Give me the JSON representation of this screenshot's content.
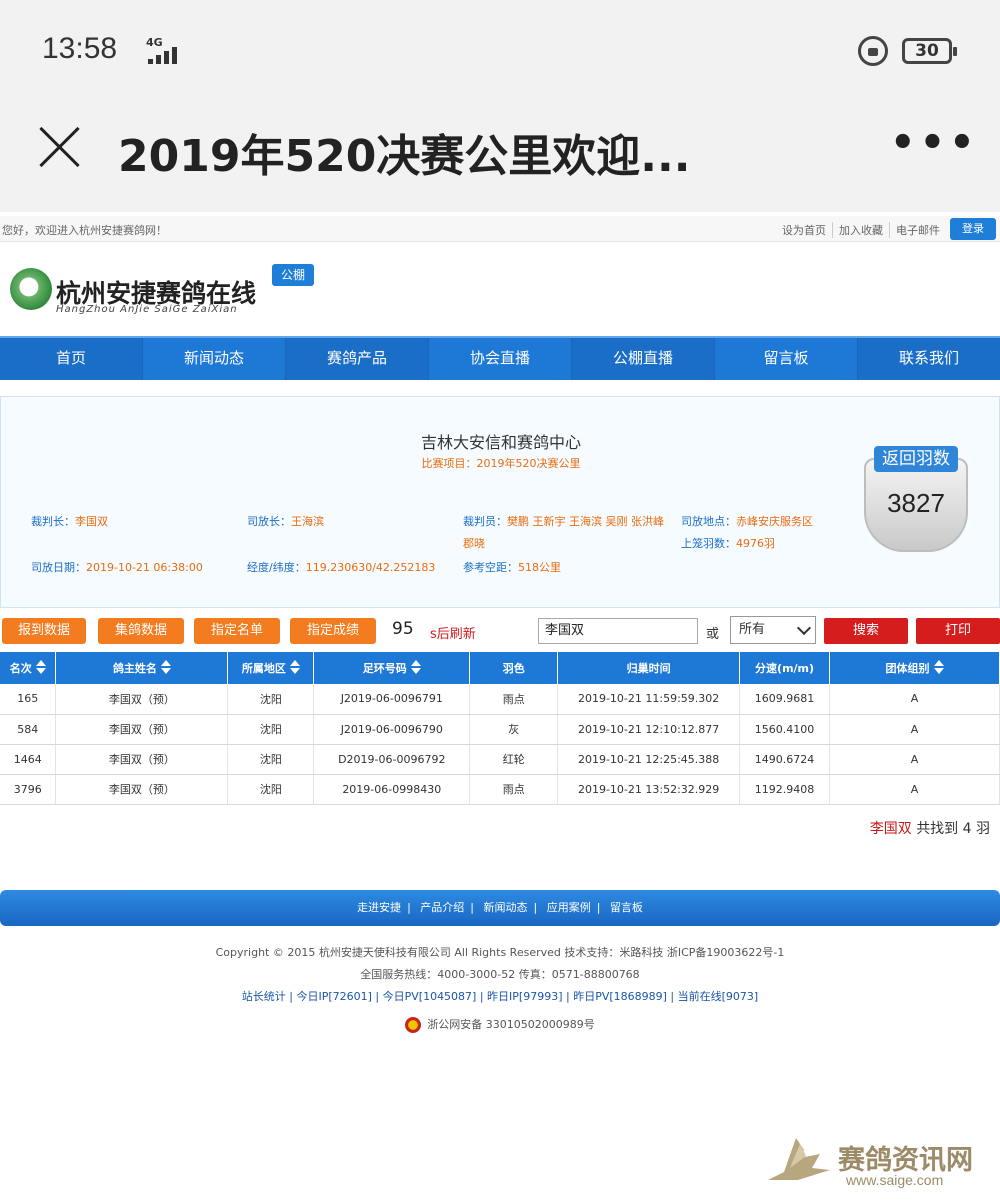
{
  "status_bar": {
    "time": "13:58",
    "network": "4G",
    "battery": "30"
  },
  "title_bar": {
    "title": "2019年520决赛公里欢迎...",
    "more": "•••"
  },
  "topstrip": {
    "welcome": "您好，欢迎进入杭州安捷赛鸽网！",
    "links": [
      "设为首页",
      "加入收藏",
      "电子邮件"
    ],
    "login": "登录"
  },
  "logo": {
    "name": "杭州安捷赛鸽在线",
    "pinyin": "HangZhou AnJie SaiGe ZaiXian",
    "badge": "公棚"
  },
  "nav": [
    "首页",
    "新闻动态",
    "赛鸽产品",
    "协会直播",
    "公棚直播",
    "留言板",
    "联系我们"
  ],
  "race": {
    "center": "吉林大安信和赛鸽中心",
    "project": "比赛项目：2019年520决赛公里",
    "fields": [
      {
        "k": "裁判长：",
        "v": "李国双"
      },
      {
        "k": "司放长：",
        "v": "王海滨"
      },
      {
        "k": "裁判员：",
        "v": "樊鹏 王新宇 王海滨 吴刚 张洪峰"
      },
      {
        "k": "司放地点：",
        "v": "赤峰安庆服务区"
      },
      {
        "k": "",
        "v": "郡晓"
      },
      {
        "k": "上笼羽数：",
        "v": "4976羽"
      },
      {
        "k": "司放日期：",
        "v": "2019-10-21 06:38:00"
      },
      {
        "k": "经度/纬度：",
        "v": "119.230630/42.252183"
      },
      {
        "k": "参考空距：",
        "v": "518公里"
      }
    ],
    "returned_label": "返回羽数",
    "returned_value": "3827"
  },
  "toolbar": {
    "btn_report": "报到数据",
    "btn_collect": "集鸽数据",
    "btn_list": "指定名单",
    "btn_result": "指定成绩",
    "refresh_seconds": "95",
    "refresh_text": "s后刷新",
    "search_value": "李国双",
    "or_label": "或",
    "select_value": "所有",
    "btn_search": "搜索",
    "btn_print": "打印"
  },
  "table": {
    "headers": [
      "名次",
      "鸽主姓名",
      "所属地区",
      "足环号码",
      "羽色",
      "归巢时间",
      "分速(m/m)",
      "团体组别"
    ],
    "rows": [
      [
        "165",
        "李国双（预）",
        "沈阳",
        "J2019-06-0096791",
        "雨点",
        "2019-10-21 11:59:59.302",
        "1609.9681",
        "A"
      ],
      [
        "584",
        "李国双（预）",
        "沈阳",
        "J2019-06-0096790",
        "灰",
        "2019-10-21 12:10:12.877",
        "1560.4100",
        "A"
      ],
      [
        "1464",
        "李国双（预）",
        "沈阳",
        "D2019-06-0096792",
        "红轮",
        "2019-10-21 12:25:45.388",
        "1490.6724",
        "A"
      ],
      [
        "3796",
        "李国双（预）",
        "沈阳",
        "2019-06-0998430",
        "雨点",
        "2019-10-21 13:52:32.929",
        "1192.9408",
        "A"
      ]
    ]
  },
  "result": {
    "name": "李国双",
    "text": "共找到 4 羽"
  },
  "footer": {
    "links": [
      "走进安捷",
      "产品介绍",
      "新闻动态",
      "应用案例",
      "留言板"
    ],
    "copyright": "Copyright © 2015 杭州安捷天使科技有限公司 All Rights Reserved 技术支持：米路科技 浙ICP备19003622号-1",
    "hotline": "全国服务热线：4000-3000-52 传真：0571-88800768",
    "stats": "站长统计 | 今日IP[72601] | 今日PV[1045087] | 昨日IP[97993] | 昨日PV[1868989] | 当前在线[9073]",
    "police": "浙公网安备 33010502000989号"
  },
  "watermark": {
    "name": "赛鸽资讯网",
    "url": "www.saige.com"
  },
  "colors": {
    "nav_blue": "#1e78d6",
    "orange": "#f47c20",
    "red": "#d51d1d",
    "accent_orange_text": "#e86c10"
  }
}
